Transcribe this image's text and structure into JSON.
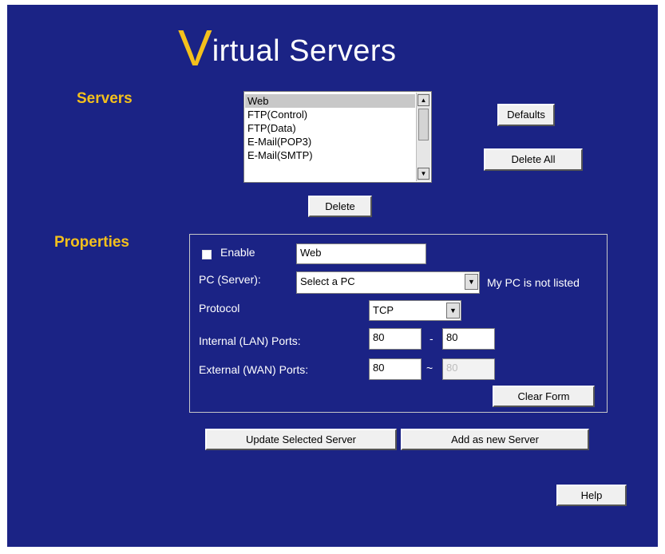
{
  "title": {
    "first_letter": "V",
    "rest": "irtual Servers"
  },
  "servers": {
    "heading": "Servers",
    "list": [
      "Web",
      "FTP(Control)",
      "FTP(Data)",
      "E-Mail(POP3)",
      "E-Mail(SMTP)"
    ],
    "selected_index": 0,
    "defaults_label": "Defaults",
    "delete_all_label": "Delete All",
    "delete_label": "Delete"
  },
  "properties": {
    "heading": "Properties",
    "enable_label": "Enable",
    "enable_checked": false,
    "server_name": "Web",
    "pc_label": "PC (Server):",
    "pc_selected": "Select a PC",
    "not_listed_label": "My PC is not listed",
    "protocol_label": "Protocol",
    "protocol_selected": "TCP",
    "internal_label": "Internal (LAN) Ports:",
    "internal_start": "80",
    "internal_sep": "-",
    "internal_end": "80",
    "external_label": "External (WAN) Ports:",
    "external_start": "80",
    "external_sep": "~",
    "external_end": "80",
    "clear_label": "Clear Form"
  },
  "actions": {
    "update_label": "Update Selected Server",
    "add_label": "Add as new Server",
    "help_label": "Help"
  },
  "colors": {
    "background": "#1b2385",
    "accent": "#f4c01c"
  }
}
